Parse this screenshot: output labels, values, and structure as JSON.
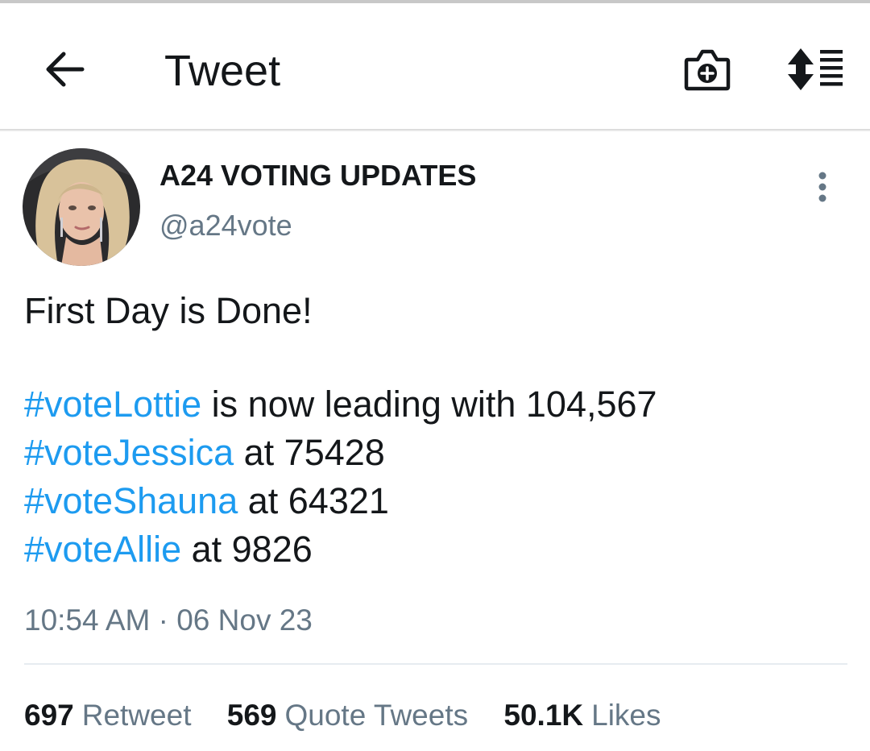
{
  "header": {
    "title": "Tweet",
    "back_icon": "arrow-left-icon",
    "camera_icon": "camera-plus-icon",
    "sort_icon": "sort-list-icon"
  },
  "tweet": {
    "author": {
      "display_name": "A24 VOTING UPDATES",
      "handle": "@a24vote"
    },
    "lines": [
      {
        "hashtag": "",
        "text": "First Day is Done!"
      },
      {
        "hashtag": "#voteLottie",
        "text": " is now leading with 104,567"
      },
      {
        "hashtag": "#voteJessica",
        "text": " at 75428"
      },
      {
        "hashtag": "#voteShauna",
        "text": " at 64321"
      },
      {
        "hashtag": "#voteAllie",
        "text": " at 9826"
      }
    ],
    "timestamp": "10:54 AM · 06 Nov 23",
    "stats": [
      {
        "count": "697",
        "label": "Retweet"
      },
      {
        "count": "569",
        "label": "Quote Tweets"
      },
      {
        "count": "50.1K",
        "label": "Likes"
      }
    ]
  },
  "colors": {
    "hashtag": "#1d9bf0",
    "secondary_text": "#657786",
    "primary_text": "#14171a"
  }
}
